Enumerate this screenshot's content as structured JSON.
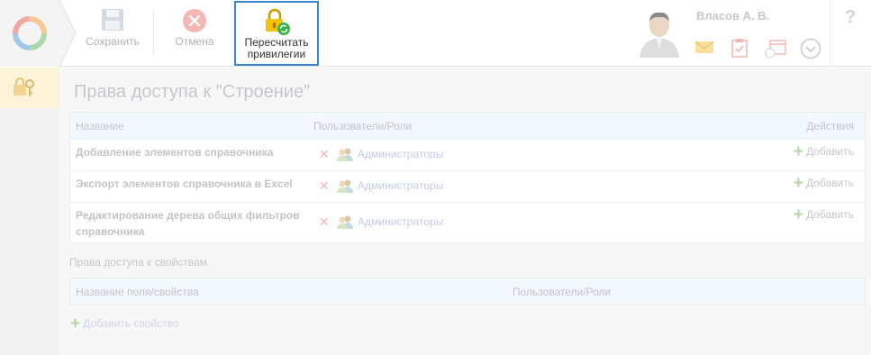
{
  "toolbar": {
    "save_label": "Сохранить",
    "cancel_label": "Отмена",
    "recalc_label_line1": "Пересчитать",
    "recalc_label_line2": "привилегии"
  },
  "user": {
    "name": "Власов А. В."
  },
  "help": {
    "label": "?"
  },
  "page": {
    "title": "Права доступа к \"Строение\""
  },
  "privileges_table": {
    "columns": {
      "name": "Название",
      "users_roles": "Пользователи/Роли",
      "actions": "Действия"
    },
    "rows": [
      {
        "name": "Добавление элементов справочника",
        "role": "Администраторы",
        "action": "Добавить"
      },
      {
        "name": "Экспорт элементов справочника в Excel",
        "role": "Администраторы",
        "action": "Добавить"
      },
      {
        "name": "Редактирование дерева общих фильтров справочника",
        "role": "Администраторы",
        "action": "Добавить"
      }
    ]
  },
  "properties_section": {
    "label": "Права доступа к свойствам",
    "columns": {
      "field_name": "Название поля/свойства",
      "users_roles": "Пользователи/Роли"
    },
    "add_label": "Добавить свойство"
  },
  "colors": {
    "accent_border": "#3a86c8",
    "title_color": "#c4c8cc",
    "role_link": "#c5cbe8",
    "delete_icon": "#f1b7b7",
    "add_icon": "#b5d8a8"
  }
}
